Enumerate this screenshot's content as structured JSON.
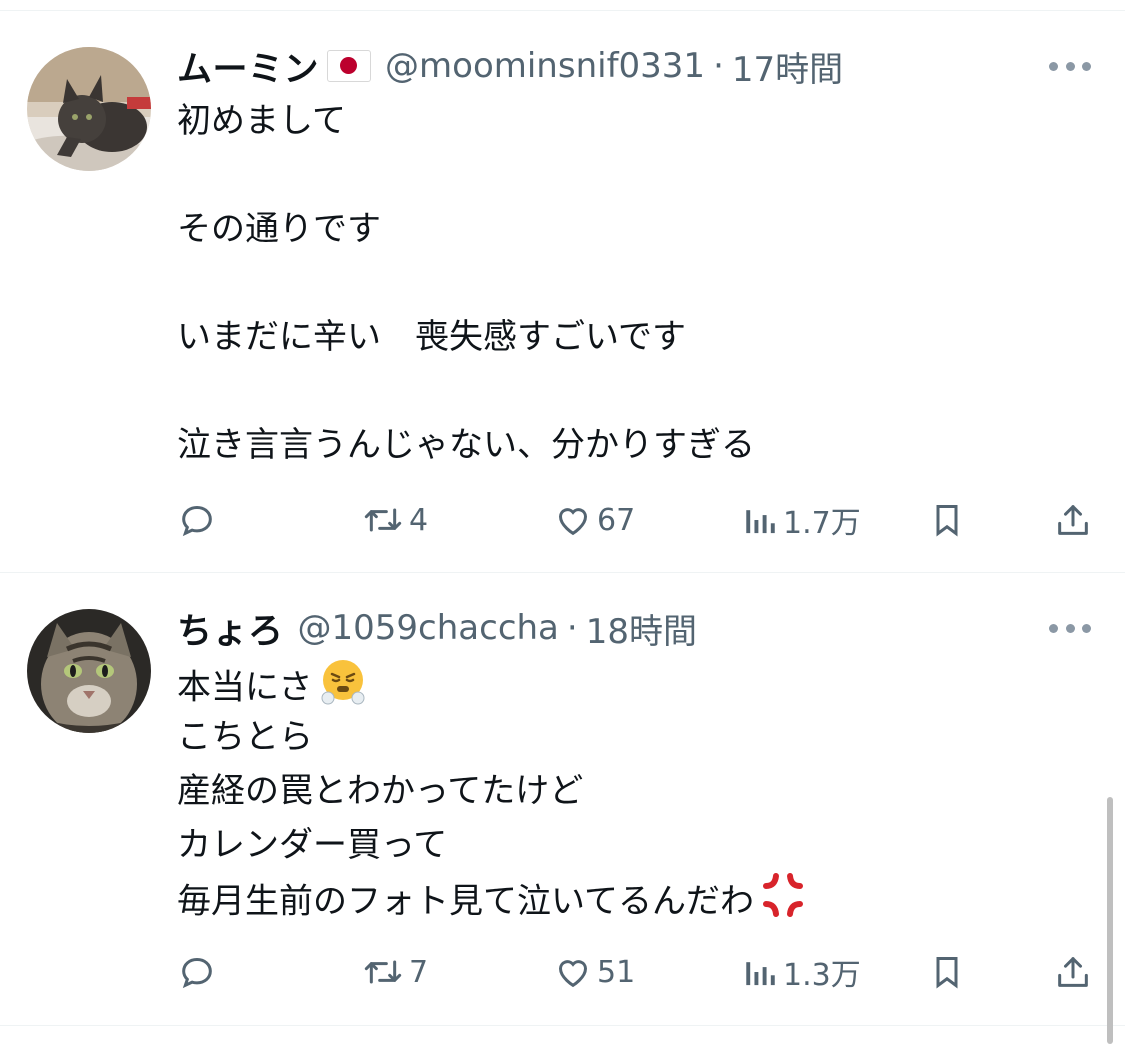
{
  "tweets": [
    {
      "name": "ムーミン",
      "handle": "@moominsnif0331",
      "separator": "·",
      "time": "17時間",
      "lines": [
        "初めまして",
        "その通りです",
        "いまだに辛い　喪失感すごいです",
        "泣き言言うんじゃない、分かりすぎる"
      ],
      "retweets": "4",
      "likes": "67",
      "views": "1.7万"
    },
    {
      "name": "ちょろ",
      "handle": "@1059chaccha",
      "separator": "·",
      "time": "18時間",
      "lines": [
        "本当にさ",
        "こちとら",
        "産経の罠とわかってたけど",
        "カレンダー買って",
        "毎月生前のフォト見て泣いてるんだわ"
      ],
      "retweets": "7",
      "likes": "51",
      "views": "1.3万"
    }
  ],
  "icons": {
    "flag": "japan-flag",
    "huff": "face-with-steam-emoji",
    "anger": "anger-symbol-emoji"
  }
}
